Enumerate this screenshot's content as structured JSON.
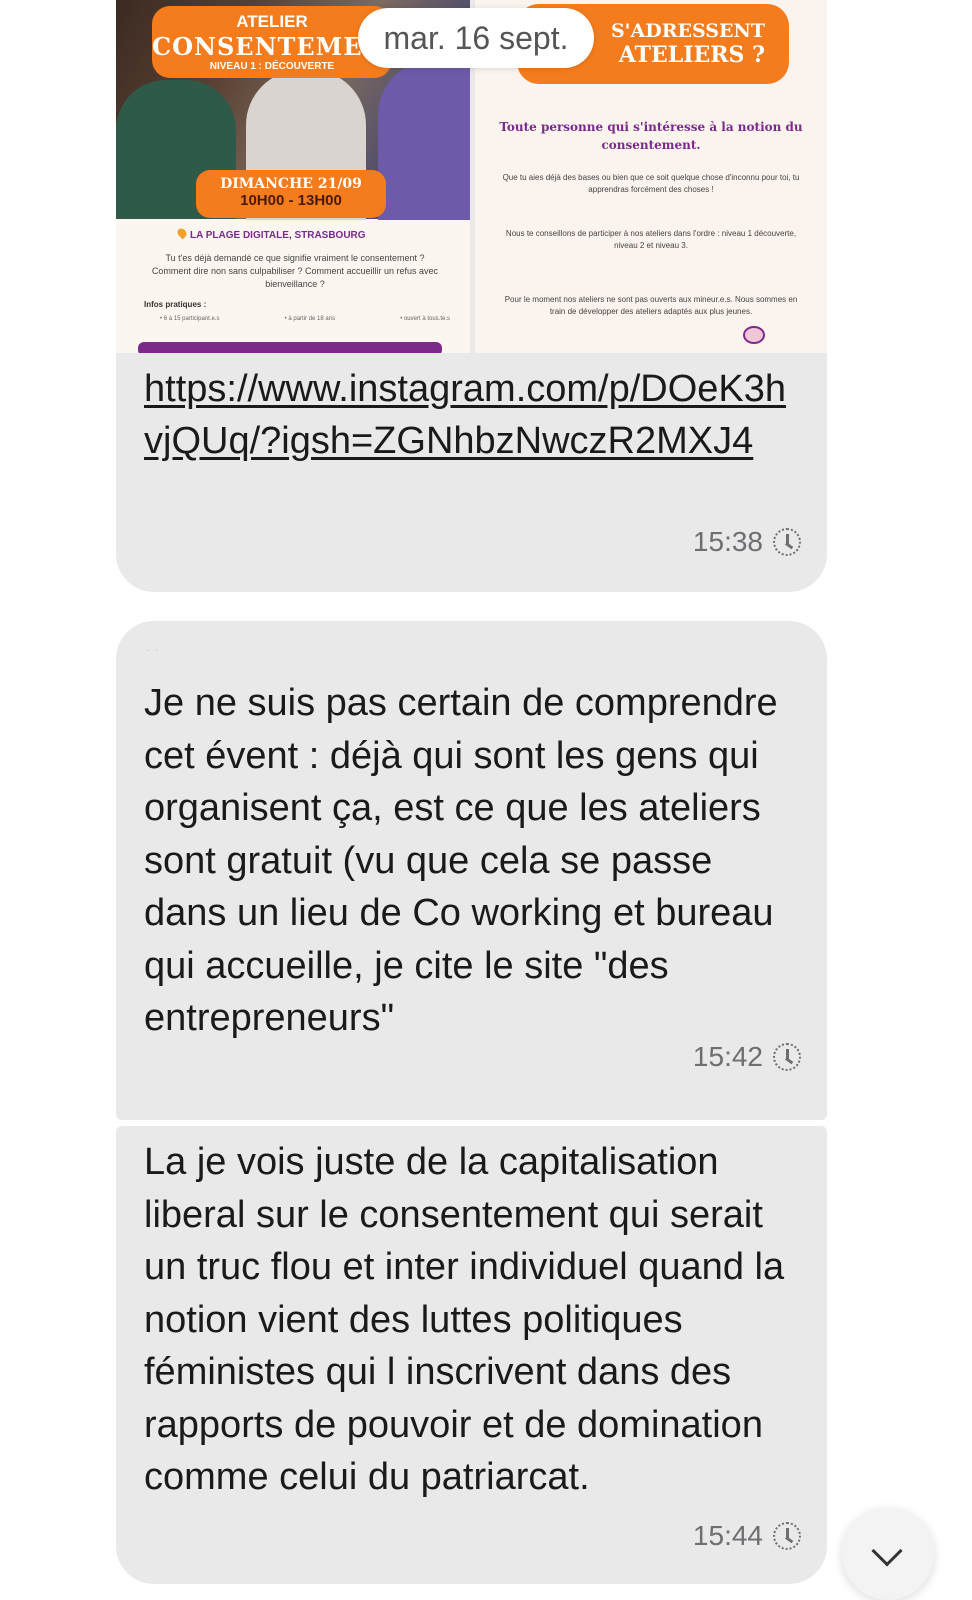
{
  "date_separator": "mar. 16 sept.",
  "messages": [
    {
      "preview_left": {
        "title_line1": "ATELIER",
        "title_line2": "CONSENTEMENT",
        "title_line3": "NIVEAU 1 : DÉCOUVERTE",
        "date_line": "DIMANCHE 21/09",
        "time_line": "10H00 - 13H00",
        "location": "LA PLAGE DIGITALE, STRASBOURG",
        "description": "Tu t'es déjà demandé ce que signifie vraiment le consentement ? Comment dire non sans culpabiliser ? Comment accueillir un refus avec bienveillance ?",
        "infos_title": "Infos pratiques :",
        "infos_items": [
          "• 6 à 15 participant.e.s",
          "• à partir de 18 ans",
          "• ouvert à tous.te.s"
        ]
      },
      "preview_right": {
        "title_line1": "S'ADRESSENT",
        "title_line2": "ATELIERS ?",
        "p1": "Toute personne qui s'intéresse à la notion du consentement.",
        "p2": "Que tu aies déjà des bases ou bien que ce soit quelque chose d'inconnu pour toi, tu apprendras forcément des choses !",
        "p3": "Nous te conseillons de participer à nos ateliers dans l'ordre : niveau 1 découverte, niveau 2 et niveau 3.",
        "p4": "Pour le moment nos ateliers ne sont pas ouverts aux mineur.e.s. Nous sommes en train de développer des ateliers adaptés aux plus jeunes."
      },
      "link": "https://www.instagram.com/p/DOeK3hvjQUq/?igsh=ZGNhbzNwczR2MXJ4",
      "time": "15:38"
    },
    {
      "text": "Je ne suis pas certain de comprendre cet évent : déjà qui sont les gens qui organisent ça, est ce que les ateliers sont gratuit (vu que cela se passe dans un lieu de Co working et bureau qui accueille, je cite le site \"des entrepreneurs\"",
      "time": "15:42"
    },
    {
      "text": "La je vois juste de la capitalisation liberal sur le consentement qui serait un truc flou et inter individuel quand la notion vient des luttes politiques féministes qui l inscrivent dans des rapports de pouvoir et de domination comme celui du patriarcat.",
      "time": "15:44"
    }
  ]
}
